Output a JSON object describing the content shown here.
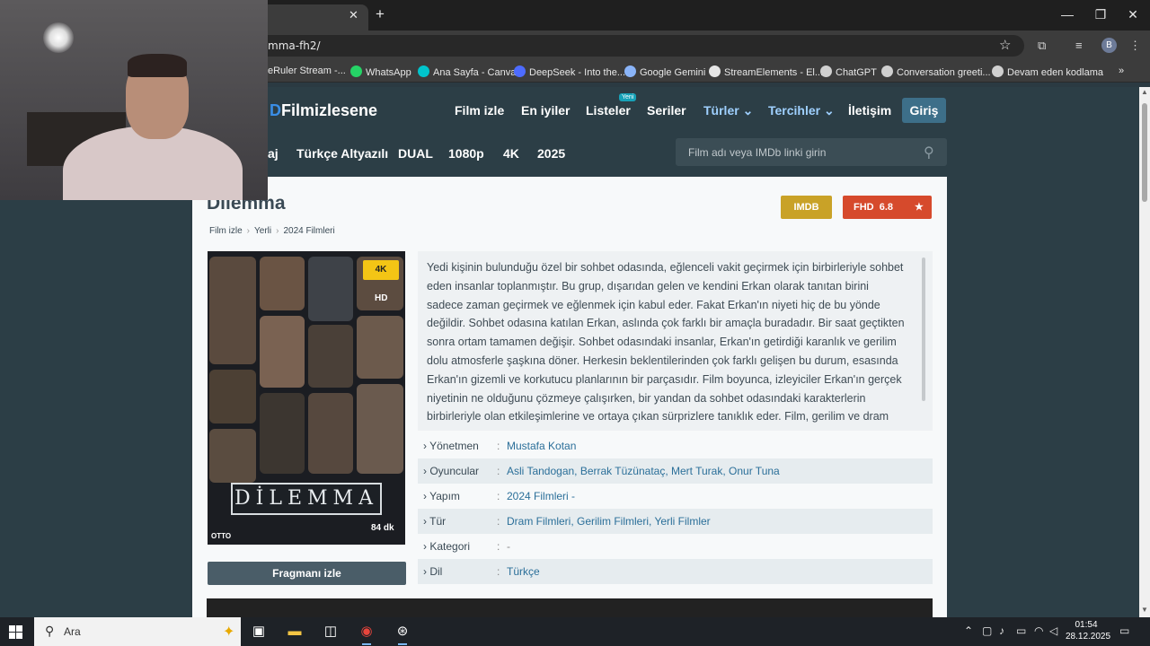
{
  "browser": {
    "tab_close": "✕",
    "tab_new": "+",
    "address": "mma-fh2/",
    "window_controls": [
      "—",
      "❐",
      "✕"
    ],
    "avatar_letter": "B",
    "bookmarks": [
      {
        "label": "eRuler Stream -...",
        "color": "#9a6cd8"
      },
      {
        "label": "WhatsApp",
        "color": "#25d366"
      },
      {
        "label": "Ana Sayfa - Canva",
        "color": "#00c4cc"
      },
      {
        "label": "DeepSeek - Into the...",
        "color": "#4d6bfe"
      },
      {
        "label": "Google Gemini",
        "color": "#8ab4f8"
      },
      {
        "label": "StreamElements - El...",
        "color": "#e6e6e6"
      },
      {
        "label": "ChatGPT",
        "color": "#d0d0d0"
      },
      {
        "label": "Conversation greeti...",
        "color": "#d0d0d0"
      },
      {
        "label": "Devam eden kodlama",
        "color": "#d0d0d0"
      }
    ],
    "more_bookmarks": "»"
  },
  "site": {
    "logo_prefix": "D",
    "logo_text": "Filmizlesene",
    "nav": [
      "Film izle",
      "En iyiler",
      "Listeler",
      "Seriler",
      "Türler ⌄",
      "Tercihler ⌄",
      "İletişim"
    ],
    "new_badge": "Yeni",
    "login": "Giriş",
    "subnav": [
      "aj",
      "Türkçe Altyazılı",
      "DUAL",
      "1080p",
      "4K",
      "2025"
    ],
    "search_placeholder": "Film adı veya IMDb linki girin"
  },
  "movie": {
    "title": "Dilemma",
    "breadcrumb": [
      "Film izle",
      "Yerli",
      "2024 Filmleri"
    ],
    "imdb_label": "IMDB",
    "fhd_label": "FHD",
    "rating": "6.8",
    "rating_star": "★",
    "quality_badge": "4K",
    "hd_label": "HD",
    "poster_title": "DİLEMMA",
    "poster_views": "84 dk",
    "poster_brand": "OTTO",
    "trailer_button": "Fragmanı izle",
    "description": "Yedi kişinin bulunduğu özel bir sohbet odasında, eğlenceli vakit geçirmek için birbirleriyle sohbet eden insanlar toplanmıştır. Bu grup, dışarıdan gelen ve kendini Erkan olarak tanıtan birini sadece zaman geçirmek ve eğlenmek için kabul eder. Fakat Erkan'ın niyeti hiç de bu yönde değildir. Sohbet odasına katılan Erkan, aslında çok farklı bir amaçla buradadır. Bir saat geçtikten sonra ortam tamamen değişir. Sohbet odasındaki insanlar, Erkan'ın getirdiği karanlık ve gerilim dolu atmosferle şaşkına döner. Herkesin beklentilerinden çok farklı gelişen bu durum, esasında Erkan'ın gizemli ve korkutucu planlarının bir parçasıdır. Film boyunca, izleyiciler Erkan'ın gerçek niyetinin ne olduğunu çözmeye çalışırken, bir yandan da sohbet odasındaki karakterlerin birbirleriyle olan etkileşimlerine ve ortaya çıkan sürprizlere tanıklık eder. Film, gerilim ve dram",
    "meta": [
      {
        "label": "Yönetmen",
        "value": "Mustafa Kotan"
      },
      {
        "label": "Oyuncular",
        "value": "Asli Tandogan, Berrak Tüzünataç, Mert Turak, Onur Tuna"
      },
      {
        "label": "Yapım",
        "value": "2024 Filmleri   -"
      },
      {
        "label": "Tür",
        "value": "Dram Filmleri, Gerilim Filmleri, Yerli Filmler"
      },
      {
        "label": "Kategori",
        "value": "-"
      },
      {
        "label": "Dil",
        "value": "Türkçe"
      }
    ]
  },
  "taskbar": {
    "search_text": "Ara",
    "time": "01:54",
    "date": "28.12.2025"
  }
}
